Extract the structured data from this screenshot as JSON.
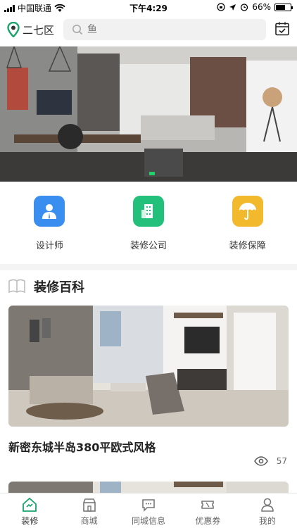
{
  "status_bar": {
    "carrier": "中国联通",
    "time": "下午4:29",
    "battery": "66%",
    "battery_level": 0.66
  },
  "header": {
    "location": "二七区",
    "search_placeholder": "鱼"
  },
  "categories": [
    {
      "label": "设计师",
      "icon": "designer-icon",
      "color": "#3a8ef0"
    },
    {
      "label": "装修公司",
      "icon": "company-building-icon",
      "color": "#22c07a"
    },
    {
      "label": "装修保障",
      "icon": "umbrella-icon",
      "color": "#f3b92c"
    }
  ],
  "section": {
    "title": "装修百科"
  },
  "articles": [
    {
      "title": "新密东城半岛380平欧式风格",
      "views": "57"
    }
  ],
  "tabs": [
    {
      "label": "装修",
      "icon": "home-icon",
      "active": true
    },
    {
      "label": "商城",
      "icon": "shop-icon"
    },
    {
      "label": "同城信息",
      "icon": "chat-icon"
    },
    {
      "label": "优惠券",
      "icon": "coupon-icon"
    },
    {
      "label": "我的",
      "icon": "user-icon"
    }
  ],
  "colors": {
    "accent": "#1aa36b"
  }
}
